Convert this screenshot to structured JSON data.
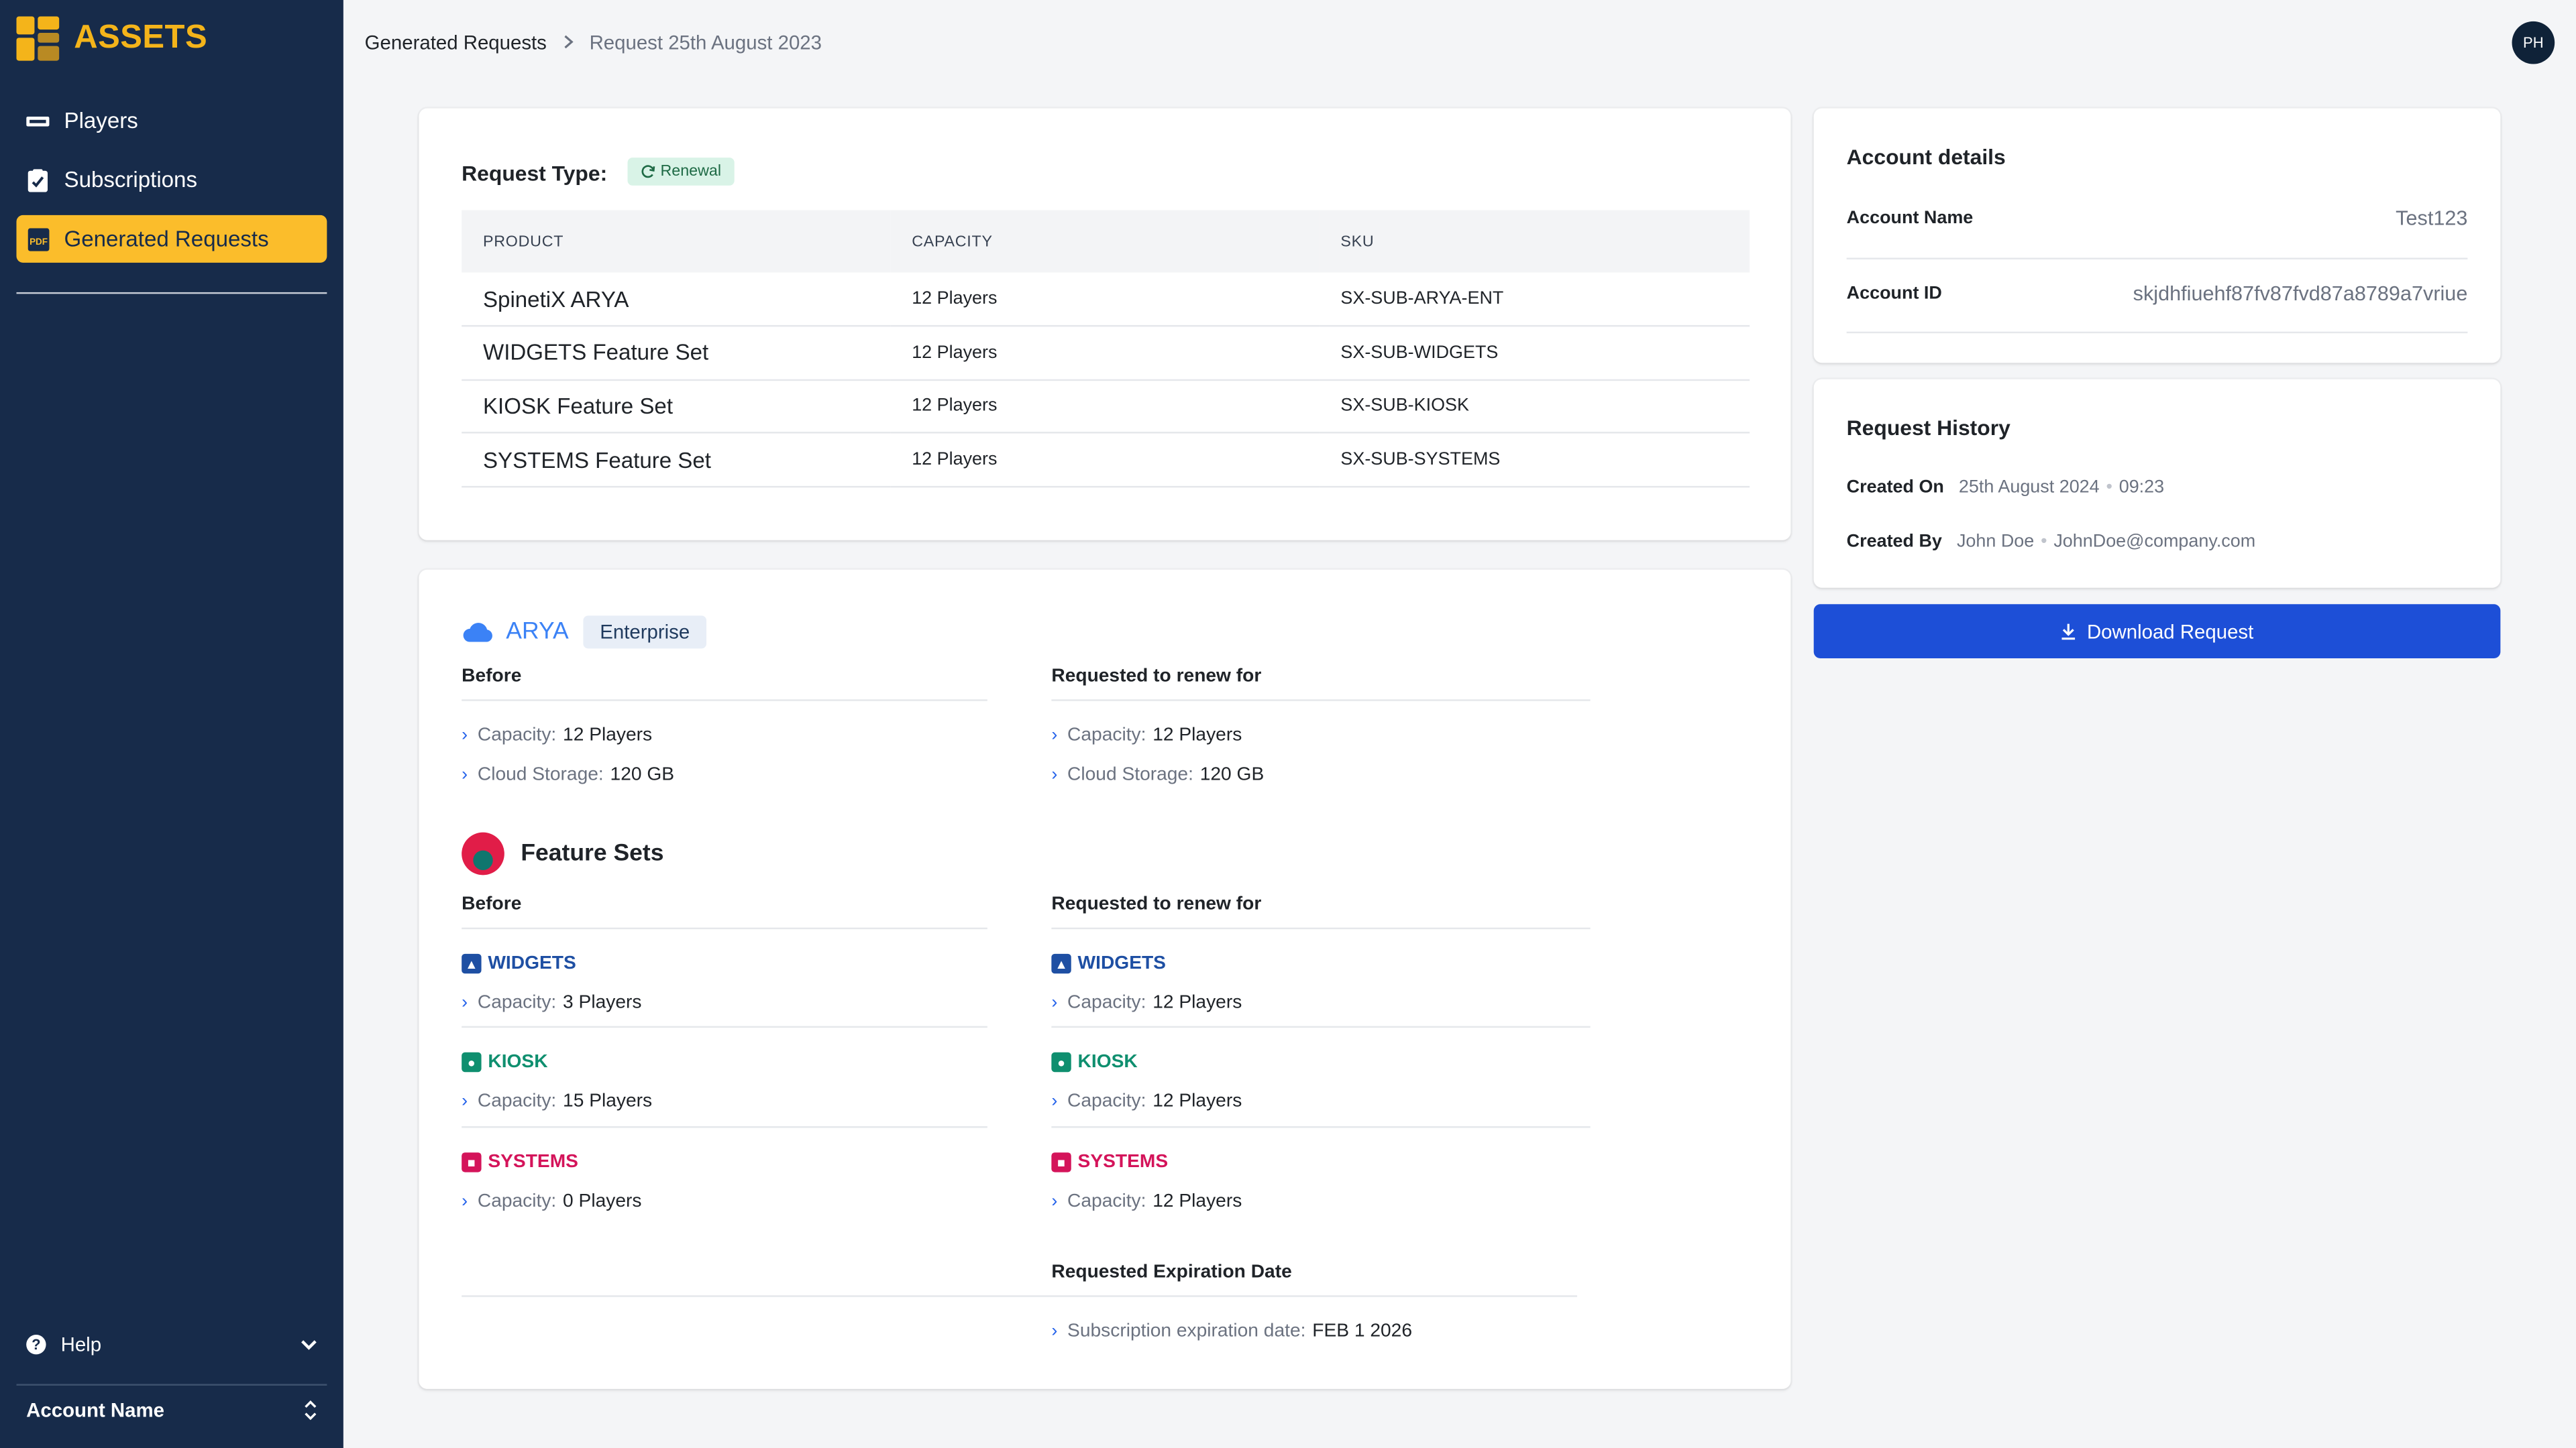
{
  "app": {
    "logo_text": "ASSETS"
  },
  "sidebar": {
    "items": [
      {
        "label": "Players",
        "icon": "player-icon"
      },
      {
        "label": "Subscriptions",
        "icon": "subscriptions-icon"
      },
      {
        "label": "Generated Requests",
        "icon": "pdf-icon",
        "active": true
      }
    ],
    "help_label": "Help",
    "account_label": "Account Name"
  },
  "header": {
    "breadcrumb": [
      "Generated Requests",
      "Request 25th August 2023"
    ],
    "avatar_initials": "PH"
  },
  "request": {
    "type_label": "Request Type:",
    "type_badge": "Renewal",
    "table": {
      "headers": [
        "PRODUCT",
        "CAPACITY",
        "SKU"
      ],
      "rows": [
        [
          "SpinetiX ARYA",
          "12 Players",
          "SX-SUB-ARYA-ENT"
        ],
        [
          "WIDGETS Feature Set",
          "12 Players",
          "SX-SUB-WIDGETS"
        ],
        [
          "KIOSK Feature Set",
          "12 Players",
          "SX-SUB-KIOSK"
        ],
        [
          "SYSTEMS Feature Set",
          "12 Players",
          "SX-SUB-SYSTEMS"
        ]
      ]
    }
  },
  "details": {
    "arya_title": "ARYA",
    "arya_badge": "Enterprise",
    "before_label": "Before",
    "renew_label": "Requested to renew for",
    "capacity_key": "Capacity:",
    "storage_key": "Cloud Storage:",
    "arya_before": {
      "capacity": "12 Players",
      "storage": "120 GB"
    },
    "arya_renew": {
      "capacity": "12 Players",
      "storage": "120 GB"
    },
    "feature_sets_title": "Feature Sets",
    "features": [
      {
        "name": "WIDGETS",
        "color": "#1e4fa3",
        "before": "3 Players",
        "renew": "12 Players"
      },
      {
        "name": "KIOSK",
        "color": "#0f8f6f",
        "before": "15 Players",
        "renew": "12 Players"
      },
      {
        "name": "SYSTEMS",
        "color": "#d4145a",
        "before": "0 Players",
        "renew": "12 Players"
      }
    ],
    "expiration_label": "Requested Expiration Date",
    "expiration_key": "Subscription expiration date:",
    "expiration_value": "FEB 1 2026"
  },
  "account": {
    "title": "Account details",
    "name_label": "Account Name",
    "name_value": "Test123",
    "id_label": "Account ID",
    "id_value": "skjdhfiuehf87fv87fvd87a8789a7vriue"
  },
  "history": {
    "title": "Request History",
    "created_on_label": "Created On",
    "created_on_date": "25th August 2024",
    "created_on_time": "09:23",
    "created_by_label": "Created By",
    "created_by_name": "John Doe",
    "created_by_email": "JohnDoe@company.com"
  },
  "download_button": "Download Request",
  "colors": {
    "sidebar_bg": "#172b4a",
    "accent": "#fbbd2b",
    "primary": "#1d4fd7"
  }
}
